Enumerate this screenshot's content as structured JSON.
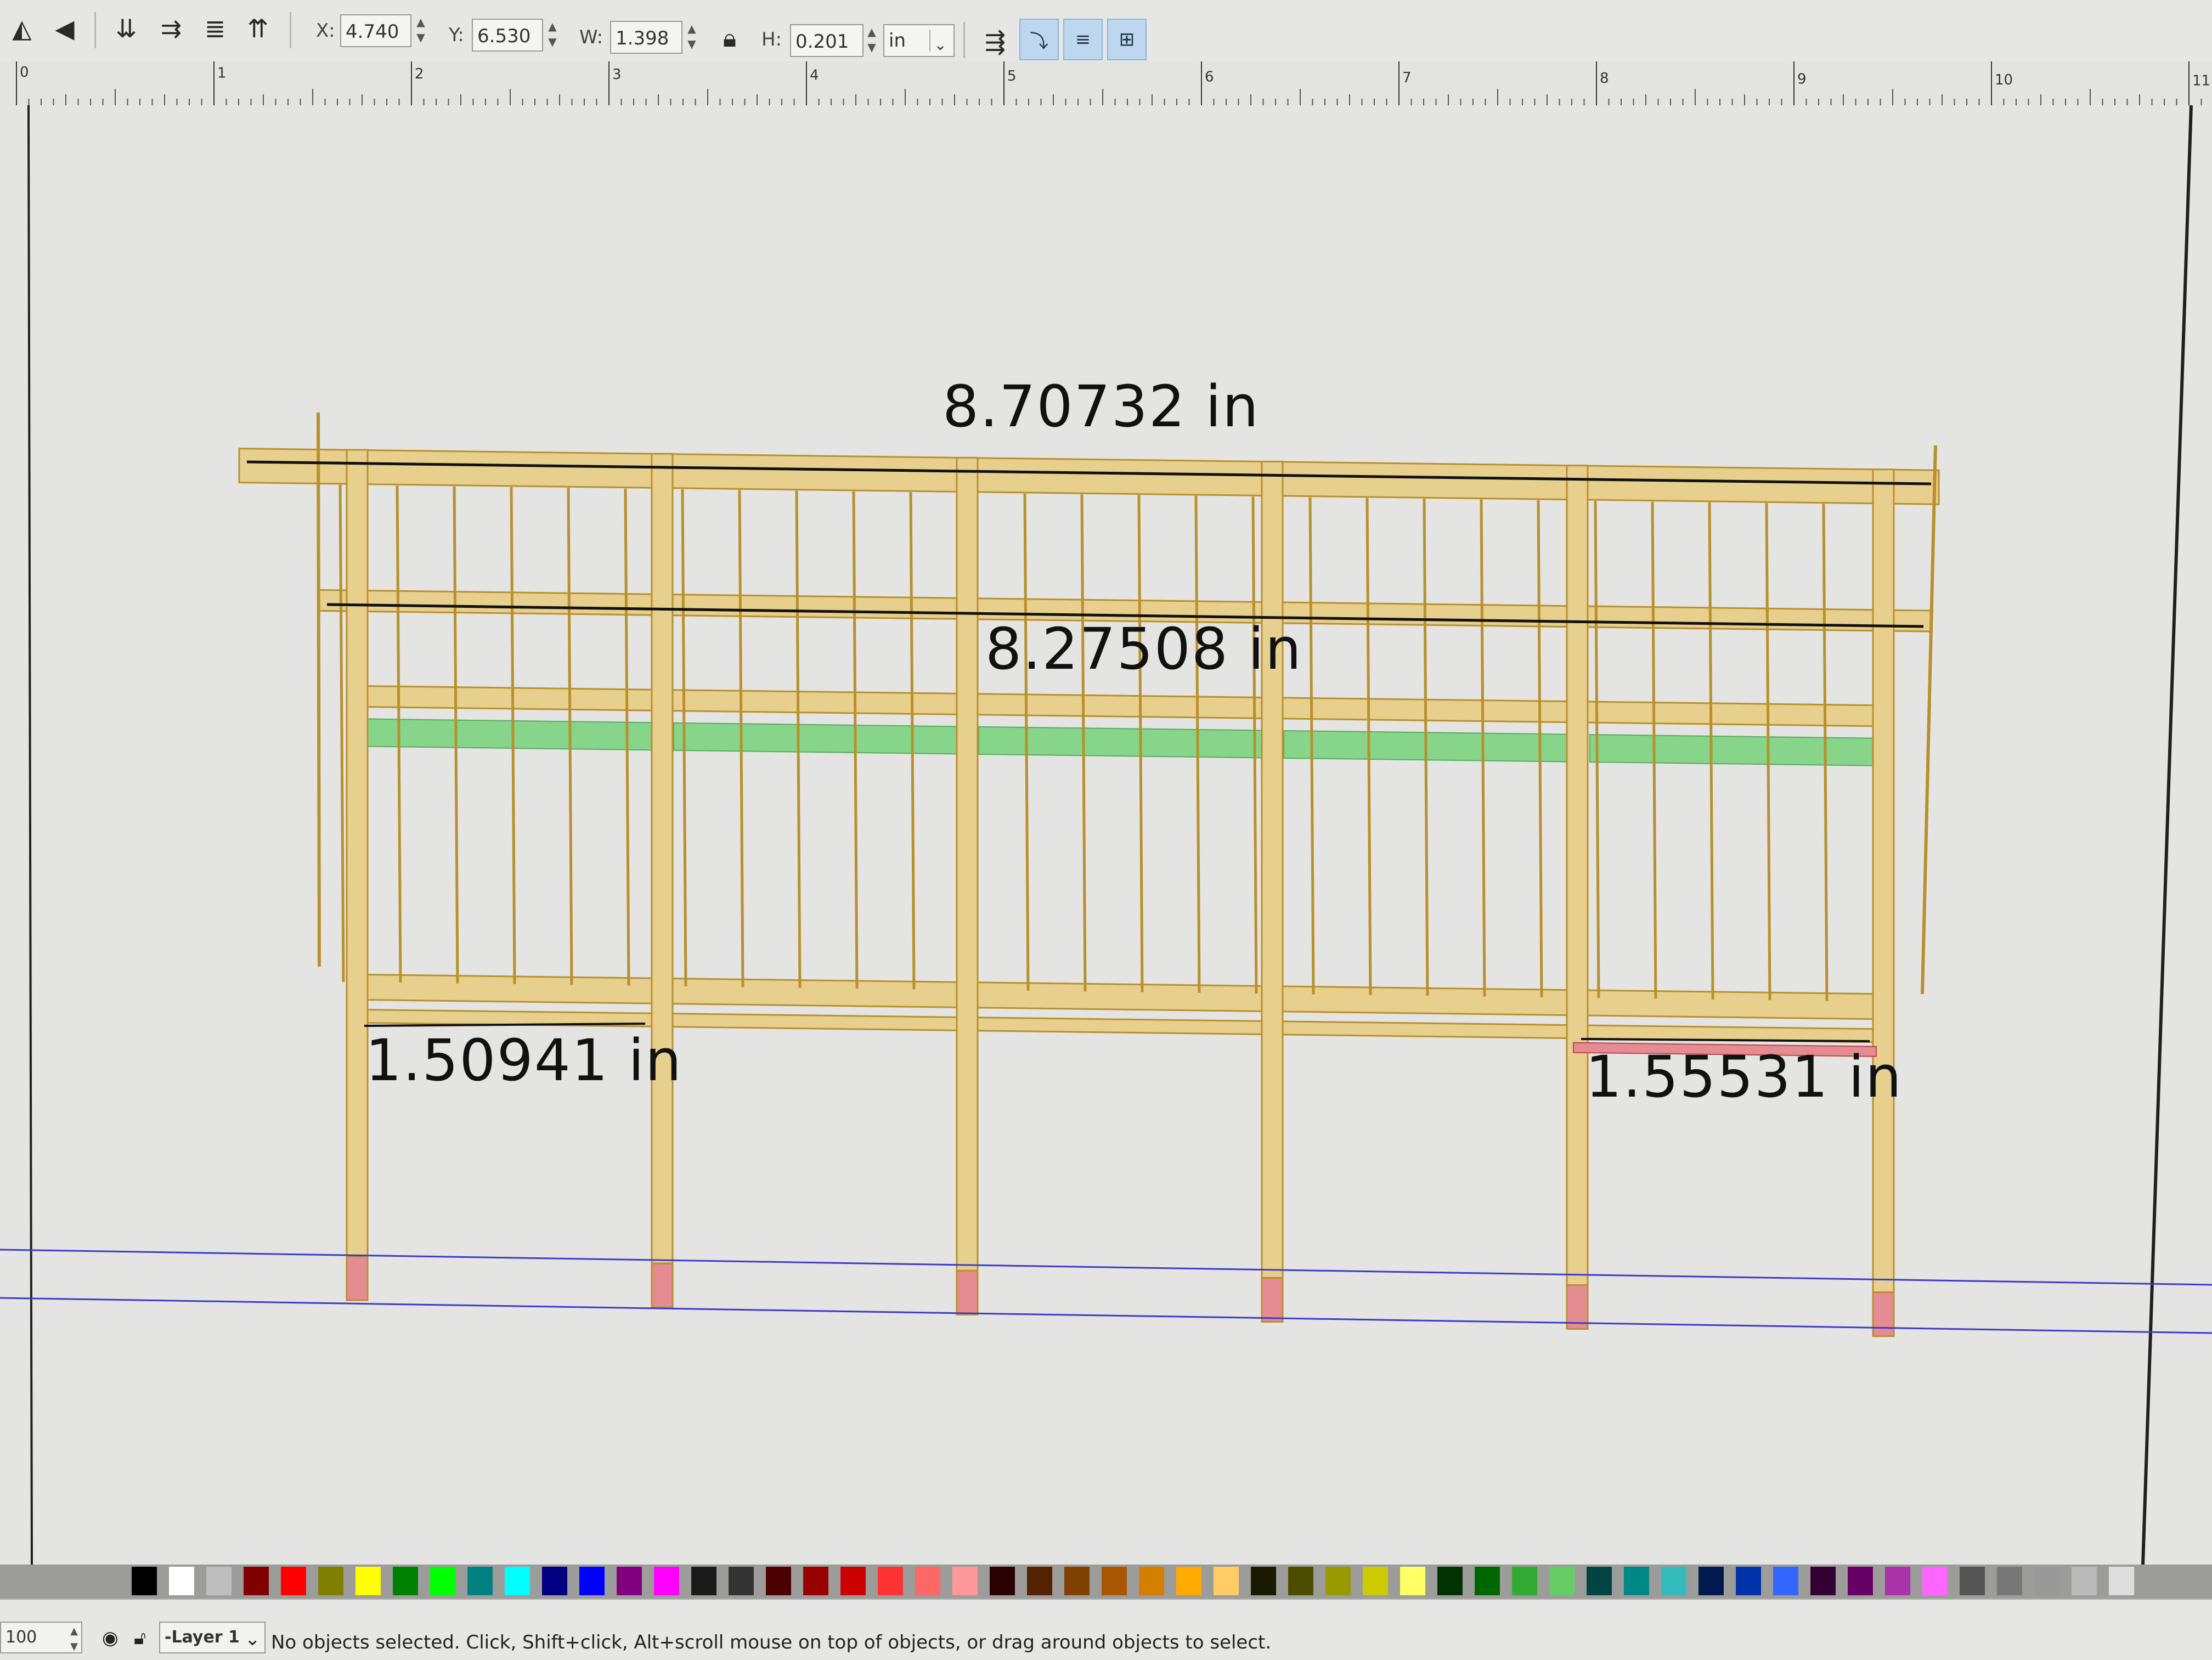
{
  "toolbar": {
    "x_label": "X:",
    "x_value": "4.740",
    "y_label": "Y:",
    "y_value": "6.530",
    "w_label": "W:",
    "w_value": "1.398",
    "h_label": "H:",
    "h_value": "0.201",
    "unit": "in",
    "icons": [
      "flip-horizontal-icon",
      "flip-vertical-icon",
      "raise-to-top-icon",
      "raise-icon",
      "lower-icon",
      "lower-to-bottom-icon",
      "lock-icon",
      "snap-scale-stroke-icon",
      "snap-scale-corners-icon",
      "snap-move-gradients-icon",
      "snap-move-patterns-icon"
    ]
  },
  "ruler": {
    "ticks": [
      "0",
      "1",
      "2",
      "3",
      "4",
      "5",
      "6",
      "7",
      "8",
      "9",
      "10",
      "11"
    ]
  },
  "canvas": {
    "dimensions": {
      "top_width": "8.70732 in",
      "inner_width": "8.27508 in",
      "left_bay": "1.50941 in",
      "right_bay": "1.55531 in"
    },
    "colors": {
      "lumber": "#e7cf8e",
      "lumber_edge": "#b8902e",
      "green_strip": "#86d58a",
      "red_block": "#e48c92",
      "guide": "#3a3acb"
    }
  },
  "palette": {
    "colors": [
      "#000000",
      "#ffffff",
      "#bebebe",
      "#800000",
      "#ff0000",
      "#808000",
      "#ffff00",
      "#008000",
      "#00ff00",
      "#008080",
      "#00ffff",
      "#000080",
      "#0000ff",
      "#800080",
      "#ff00ff",
      "#1a1a1a",
      "#333333",
      "#4d0000",
      "#990000",
      "#cc0000",
      "#ff3333",
      "#ff6666",
      "#ff9999",
      "#2b0000",
      "#552200",
      "#804000",
      "#aa5500",
      "#d47f00",
      "#ffaa00",
      "#ffcc66",
      "#1a1a00",
      "#4d4d00",
      "#999900",
      "#cccc00",
      "#ffff66",
      "#003300",
      "#006600",
      "#33aa33",
      "#66cc66",
      "#004444",
      "#008888",
      "#33bbbb",
      "#001a4d",
      "#0033aa",
      "#3366ff",
      "#330033",
      "#660066",
      "#aa33aa",
      "#ff66ff",
      "#555555",
      "#777777",
      "#999999",
      "#bbbbbb",
      "#dddddd"
    ]
  },
  "statusbar": {
    "zoom": "100",
    "layer": "-Layer 1",
    "message": "No objects selected. Click, Shift+click, Alt+scroll mouse on top of objects, or drag around objects to select."
  }
}
